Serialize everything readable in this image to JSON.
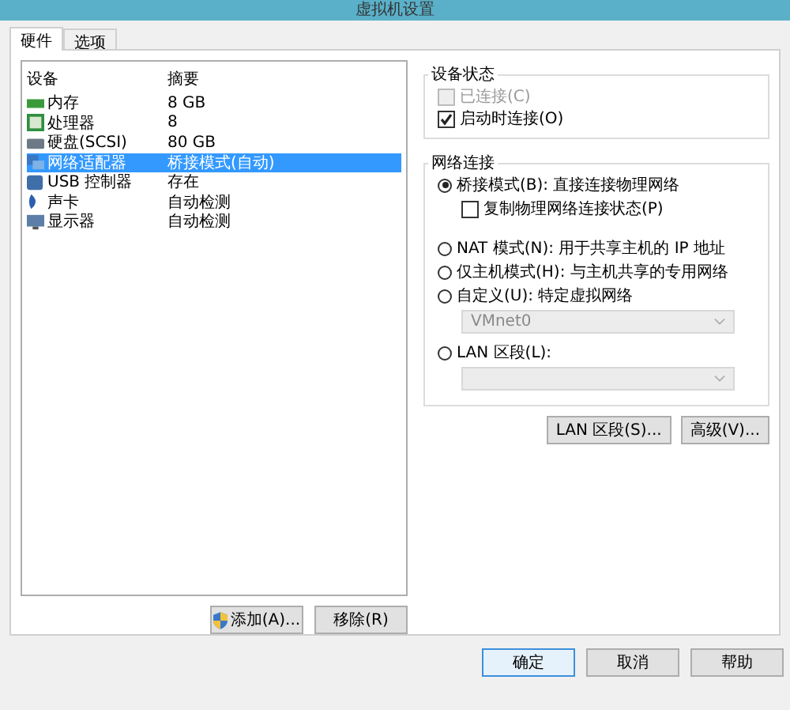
{
  "window": {
    "title": "虚拟机设置"
  },
  "tabs": [
    {
      "label": "硬件",
      "selected": true
    },
    {
      "label": "选项",
      "selected": false
    }
  ],
  "device_table": {
    "columns": [
      "设备",
      "摘要"
    ],
    "rows": [
      {
        "kind": "memory",
        "device": "内存",
        "summary": "8 GB",
        "selected": false
      },
      {
        "kind": "cpu",
        "device": "处理器",
        "summary": "8",
        "selected": false
      },
      {
        "kind": "disk",
        "device": "硬盘(SCSI)",
        "summary": "80 GB",
        "selected": false
      },
      {
        "kind": "network",
        "device": "网络适配器",
        "summary": "桥接模式(自动)",
        "selected": true
      },
      {
        "kind": "usb",
        "device": "USB 控制器",
        "summary": "存在",
        "selected": false
      },
      {
        "kind": "sound",
        "device": "声卡",
        "summary": "自动检测",
        "selected": false
      },
      {
        "kind": "display",
        "device": "显示器",
        "summary": "自动检测",
        "selected": false
      }
    ]
  },
  "device_buttons": [
    {
      "label": "添加(A)...",
      "shield": true
    },
    {
      "label": "移除(R)",
      "shield": false
    }
  ],
  "device_status": {
    "title": "设备状态",
    "options": [
      {
        "label": "已连接(C)",
        "checked": false,
        "disabled": true
      },
      {
        "label": "启动时连接(O)",
        "checked": true,
        "disabled": false
      }
    ]
  },
  "network_connection": {
    "title": "网络连接",
    "items": [
      {
        "kind": "radio",
        "label": "桥接模式(B): 直接连接物理网络",
        "selected": true
      },
      {
        "kind": "checkbox",
        "label": "复制物理网络连接状态(P)",
        "checked": false
      },
      {
        "kind": "radio",
        "label": "NAT 模式(N): 用于共享主机的 IP 地址",
        "selected": false
      },
      {
        "kind": "radio",
        "label": "仅主机模式(H): 与主机共享的专用网络",
        "selected": false
      },
      {
        "kind": "radio",
        "label": "自定义(U): 特定虚拟网络",
        "selected": false
      },
      {
        "kind": "dropdown",
        "value": "VMnet0",
        "disabled": true
      },
      {
        "kind": "radio",
        "label": "LAN 区段(L):",
        "selected": false
      },
      {
        "kind": "dropdown",
        "value": "",
        "disabled": true
      }
    ]
  },
  "network_buttons": [
    "LAN 区段(S)...",
    "高级(V)..."
  ],
  "dialog_buttons": [
    {
      "label": "确定",
      "default": true
    },
    {
      "label": "取消",
      "default": false
    },
    {
      "label": "帮助",
      "default": false
    }
  ]
}
